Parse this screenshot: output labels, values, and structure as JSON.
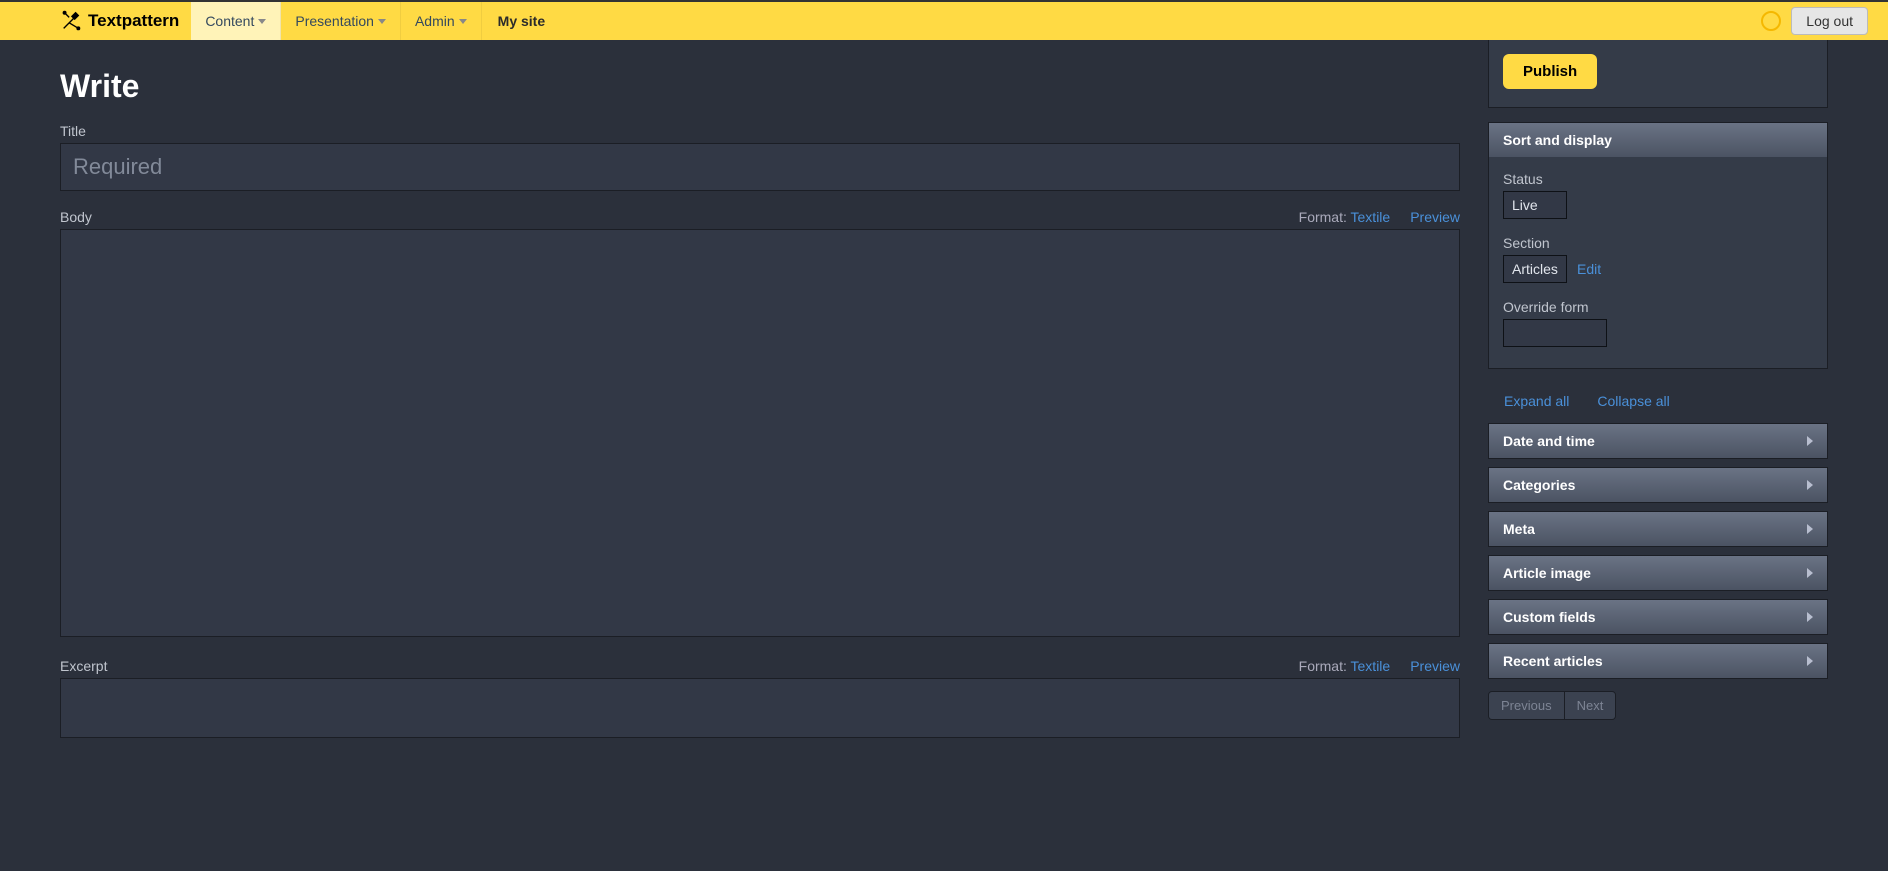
{
  "brand": "Textpattern",
  "nav": {
    "content": "Content",
    "presentation": "Presentation",
    "admin": "Admin",
    "mysite": "My site",
    "logout": "Log out"
  },
  "page": {
    "heading": "Write",
    "title_label": "Title",
    "title_placeholder": "Required",
    "body_label": "Body",
    "excerpt_label": "Excerpt",
    "format_prefix": "Format:",
    "format_value": "Textile",
    "preview": "Preview"
  },
  "publish": {
    "button": "Publish"
  },
  "sort": {
    "header": "Sort and display",
    "status_label": "Status",
    "status_value": "Live",
    "section_label": "Section",
    "section_value": "Articles",
    "section_edit": "Edit",
    "override_label": "Override form"
  },
  "toggles": {
    "expand": "Expand all",
    "collapse": "Collapse all"
  },
  "accordion": {
    "datetime": "Date and time",
    "categories": "Categories",
    "meta": "Meta",
    "article_image": "Article image",
    "custom_fields": "Custom fields",
    "recent": "Recent articles"
  },
  "pager": {
    "prev": "Previous",
    "next": "Next"
  }
}
